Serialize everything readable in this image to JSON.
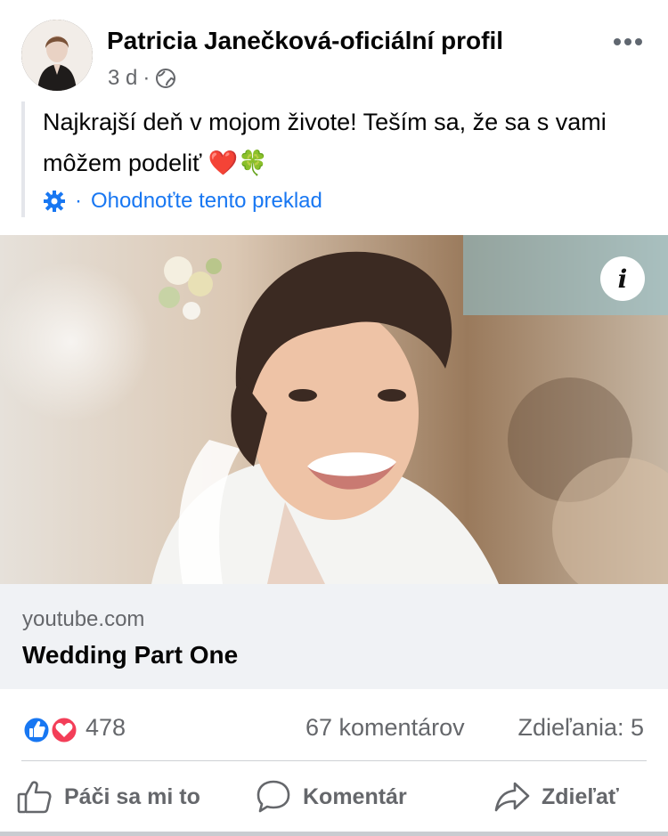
{
  "post": {
    "author": "Patricia Janečková-oficiální profil",
    "time": "3 d",
    "separator": "·",
    "privacy_icon": "globe-icon",
    "more_icon": "more-horizontal-icon",
    "text": "Najkrajší deň v mojom živote! Teším sa, že sa s vami môžem podeliť ❤️🍀",
    "translate": {
      "separator": "·",
      "label": "Ohodnoťte tento preklad",
      "icon": "gear-icon"
    }
  },
  "media": {
    "info_label": "i"
  },
  "link": {
    "domain": "youtube.com",
    "title": "Wedding Part One"
  },
  "engagement": {
    "reaction_count": "478",
    "comments": "67 komentárov",
    "shares": "Zdieľania: 5"
  },
  "actions": {
    "like": "Páči sa mi to",
    "comment": "Komentár",
    "share": "Zdieľať"
  },
  "colors": {
    "accent": "#1877f2",
    "like_blue": "#1877f2",
    "love_red": "#f33e58",
    "muted_text": "#65676b"
  }
}
